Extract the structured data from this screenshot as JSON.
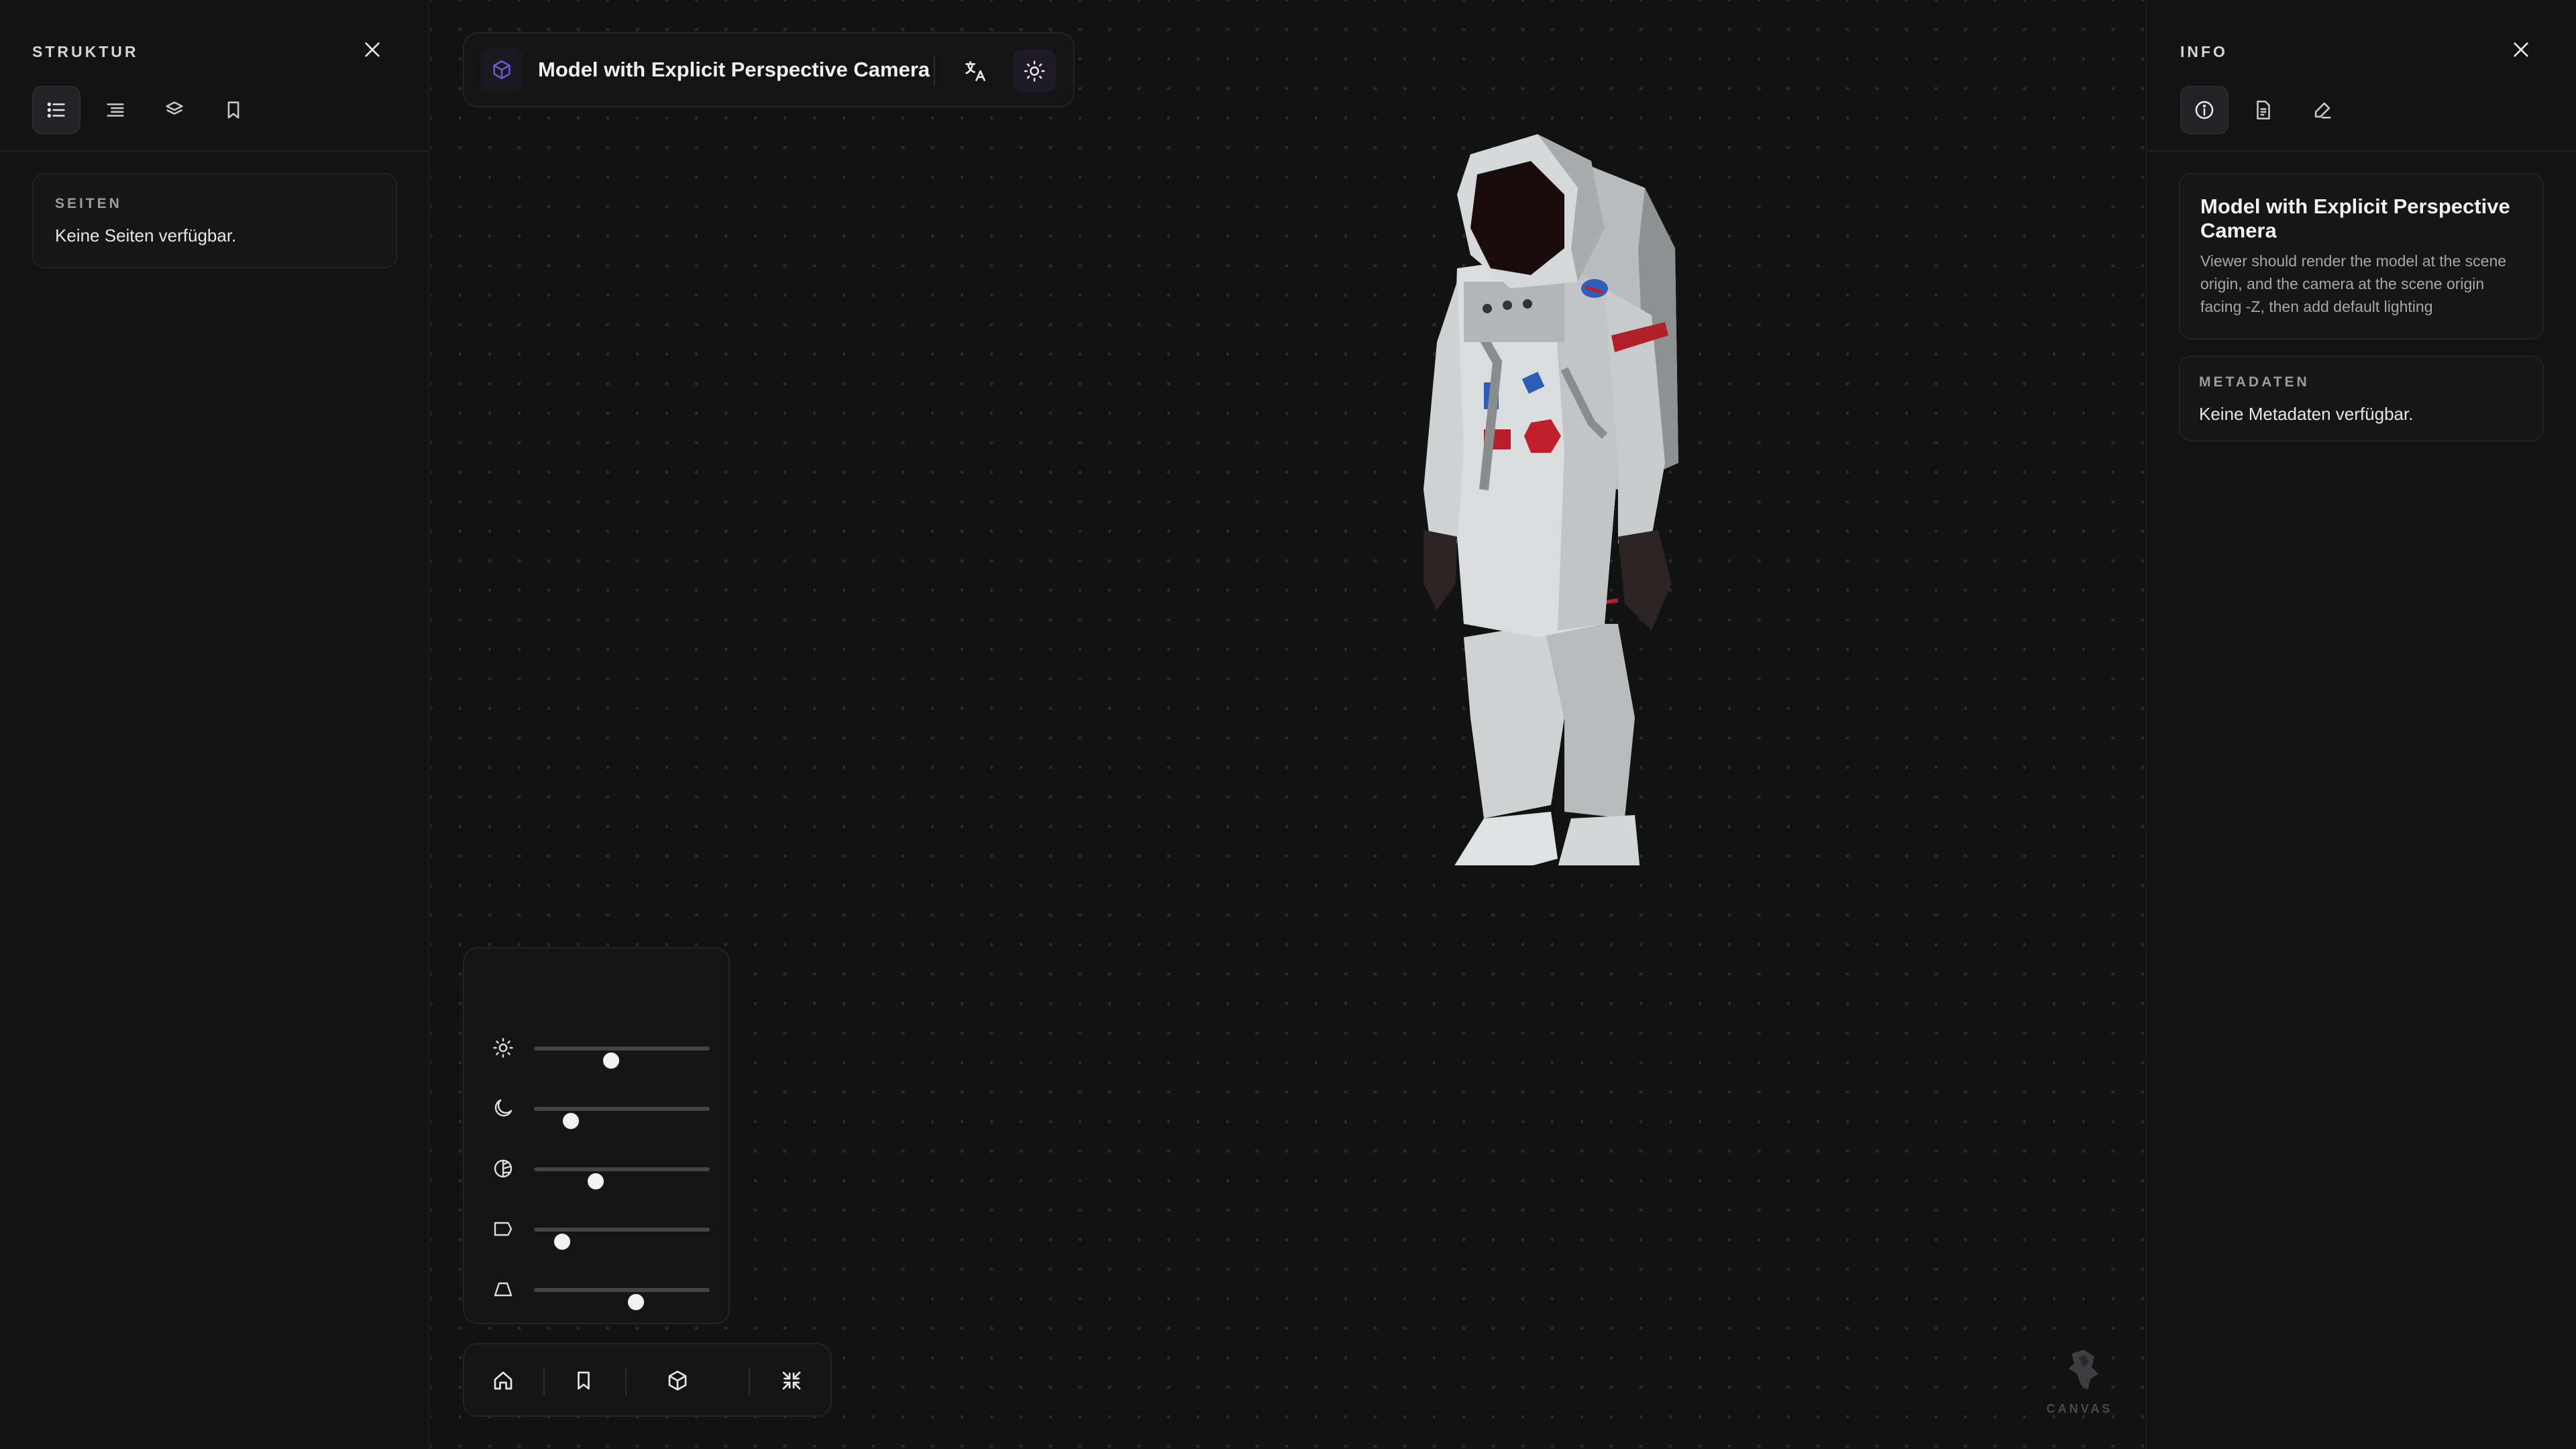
{
  "left_panel": {
    "title": "STRUKTUR",
    "tabs": [
      "list-icon",
      "outline-icon",
      "layers-icon",
      "bookmark-icon"
    ],
    "pages_card": {
      "label": "SEITEN",
      "text": "Keine Seiten verfügbar."
    }
  },
  "topbar": {
    "title": "Model with Explicit Perspective Camera",
    "accent": "#7c5cd6"
  },
  "right_panel": {
    "title": "INFO",
    "tabs": [
      "info-icon",
      "document-icon",
      "annotate-icon"
    ],
    "info_card": {
      "title": "Model with Explicit Perspective Camera",
      "description": "Viewer should render the model at the scene origin, and the camera at the scene origin facing -Z, then add default lighting"
    },
    "metadata_card": {
      "label": "METADATEN",
      "text": "Keine Metadaten verfügbar."
    }
  },
  "sliders": [
    {
      "icon": "brightness-icon",
      "value": 0.44
    },
    {
      "icon": "moon-icon",
      "value": 0.21
    },
    {
      "icon": "contrast-icon",
      "value": 0.35
    },
    {
      "icon": "flag-icon",
      "value": 0.16
    },
    {
      "icon": "perspective-icon",
      "value": 0.58
    }
  ],
  "bottom_toolbar": [
    "home-icon",
    "bookmark-icon",
    "cube-icon",
    "collapse-icon"
  ],
  "canvas_logo": {
    "text": "CANVAS"
  }
}
